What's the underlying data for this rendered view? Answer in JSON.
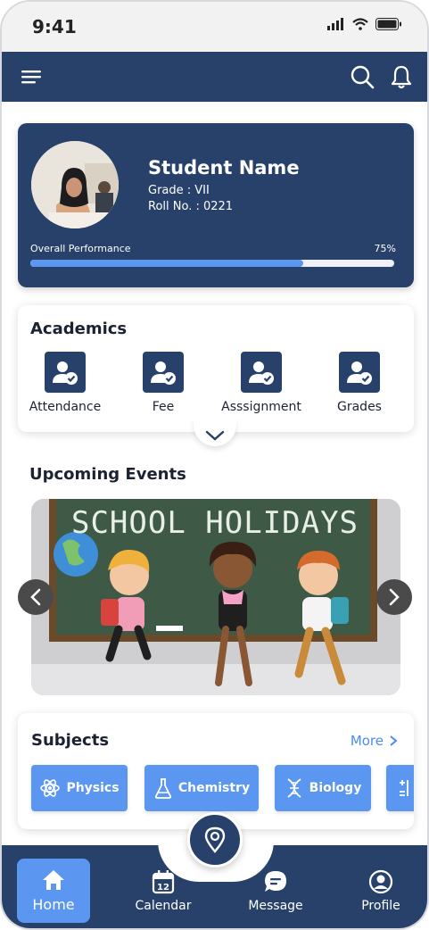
{
  "status": {
    "time": "9:41"
  },
  "header": {
    "menu_icon": "hamburger-icon",
    "search_icon": "search-icon",
    "bell_icon": "bell-icon"
  },
  "profile": {
    "name": "Student Name",
    "grade": "Grade : VII",
    "roll": "Roll No. : 0221",
    "performance_label": "Overall Performance",
    "performance_value": "75%",
    "performance_fraction": 0.75
  },
  "academics": {
    "title": "Academics",
    "items": [
      {
        "label": "Attendance",
        "icon": "user-check-icon"
      },
      {
        "label": "Fee",
        "icon": "user-check-icon"
      },
      {
        "label": "Asssignment",
        "icon": "user-check-icon"
      },
      {
        "label": "Grades",
        "icon": "user-check-icon"
      }
    ]
  },
  "events": {
    "title": "Upcoming Events",
    "banner_text": "SCHOOL HOLIDAYS"
  },
  "subjects": {
    "title": "Subjects",
    "more": "More",
    "items": [
      {
        "label": "Physics",
        "icon": "atom-icon"
      },
      {
        "label": "Chemistry",
        "icon": "flask-icon"
      },
      {
        "label": "Biology",
        "icon": "dna-icon"
      }
    ]
  },
  "nav": {
    "items": [
      {
        "label": "Home",
        "icon": "home-icon"
      },
      {
        "label": "Calendar",
        "icon": "calendar-icon",
        "badge": "12"
      },
      {
        "label": "Message",
        "icon": "message-icon"
      },
      {
        "label": "Profile",
        "icon": "profile-icon"
      }
    ]
  },
  "colors": {
    "primary": "#28416b",
    "accent": "#5b97f0",
    "link": "#4b8cf0"
  }
}
